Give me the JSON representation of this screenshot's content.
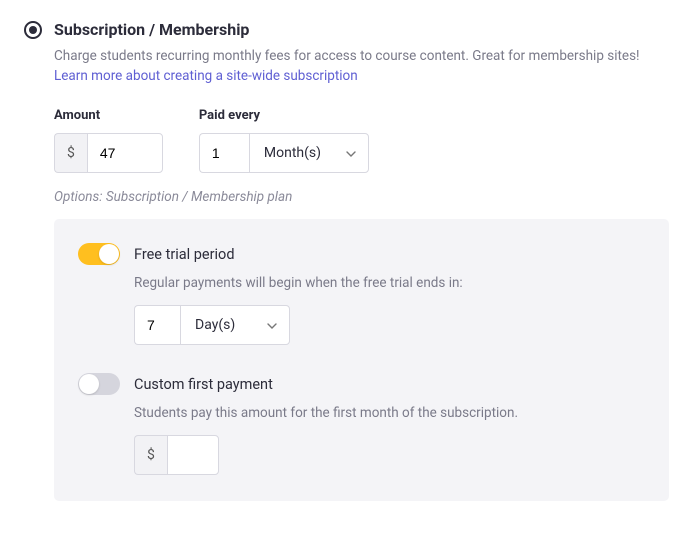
{
  "title": "Subscription / Membership",
  "description": "Charge students recurring monthly fees for access to course content. Great for membership sites!",
  "link_text": "Learn more about creating a site-wide subscription",
  "amount": {
    "label": "Amount",
    "currency": "$",
    "value": "47"
  },
  "paid_every": {
    "label": "Paid every",
    "value": "1",
    "unit": "Month(s)"
  },
  "options_note": "Options: Subscription / Membership plan",
  "free_trial": {
    "label": "Free trial period",
    "desc": "Regular payments will begin when the free trial ends in:",
    "value": "7",
    "unit": "Day(s)"
  },
  "custom_first": {
    "label": "Custom first payment",
    "desc": "Students pay this amount for the first month of the subscription.",
    "currency": "$",
    "value": ""
  }
}
